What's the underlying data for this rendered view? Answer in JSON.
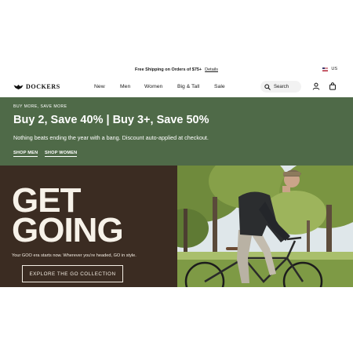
{
  "announcement": {
    "message": "Free Shipping on Orders of $75+",
    "details_link": "Details",
    "locale": "US"
  },
  "header": {
    "logo_text": "DOCKERS",
    "nav": [
      "New",
      "Men",
      "Women",
      "Big & Tall",
      "Sale"
    ],
    "search_label": "Search",
    "icons": [
      "user-icon",
      "bag-icon",
      "search-icon"
    ]
  },
  "promo": {
    "eyebrow": "BUY MORE, SAVE MORE",
    "headline": "Buy 2, Save 40% | Buy 3+, Save 50%",
    "subtext": "Nothing beats ending the year with a bang. Discount auto-applied at checkout.",
    "links": [
      "SHOP MEN",
      "SHOP WOMEN"
    ],
    "colors": {
      "background": "#4f6a48",
      "text": "#ffffff"
    }
  },
  "hero": {
    "headline_line1": "GET",
    "headline_line2": "GOING",
    "tagline": "Your GOO era starts now. Wherever you're headed, GO in style.",
    "cta": "EXPLORE THE GO COLLECTION",
    "colors": {
      "panel": "#3b2c22",
      "text": "#f7f2e9"
    }
  }
}
